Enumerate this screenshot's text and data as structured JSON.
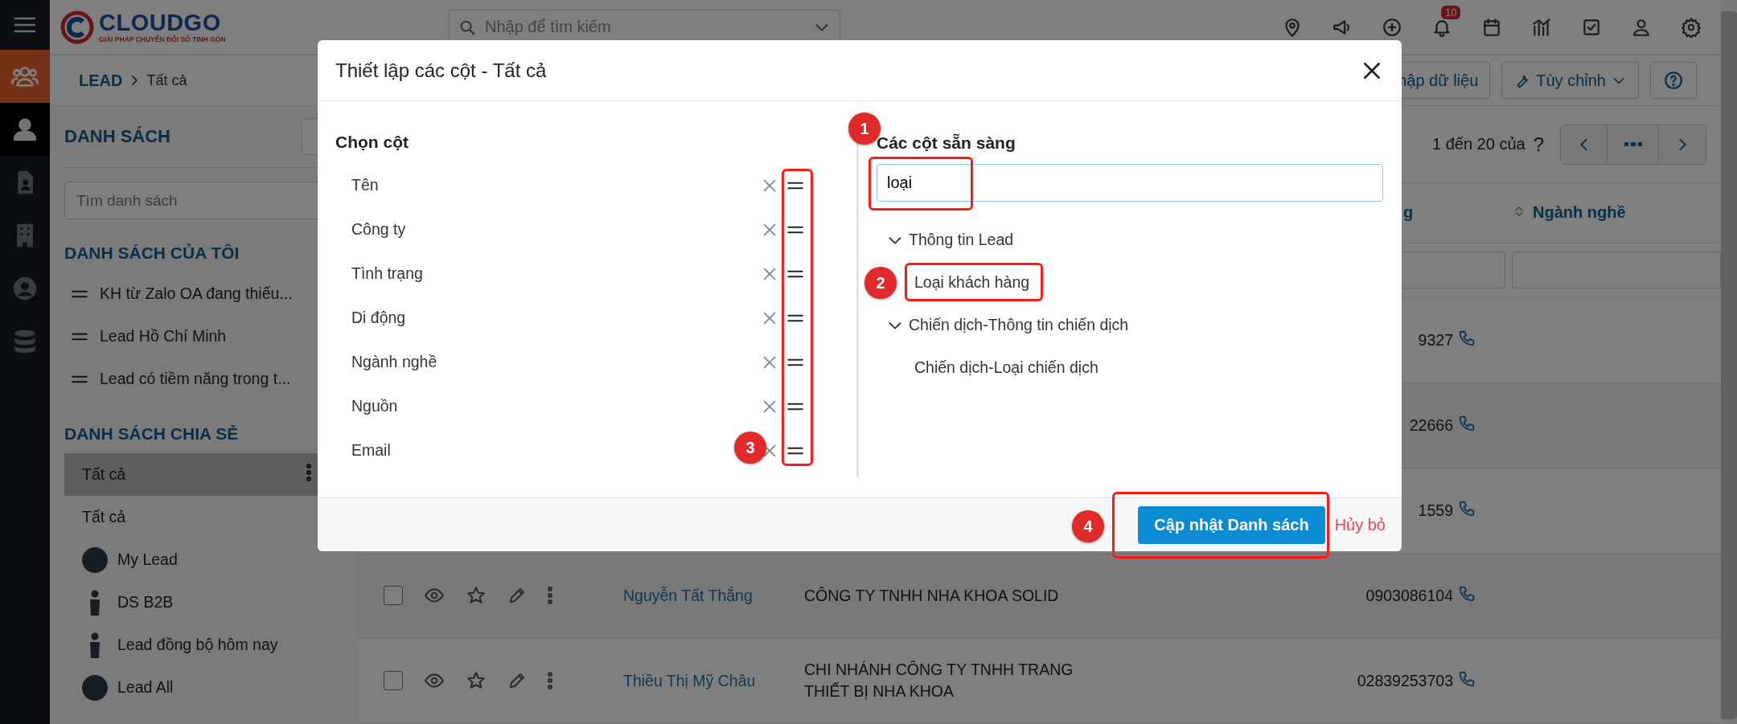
{
  "header": {
    "logo": {
      "name": "CLOUDGO",
      "tagline": "GIẢI PHÁP CHUYỂN ĐỔI SỐ TINH GỌN"
    },
    "search": {
      "placeholder": "Nhập để tìm kiếm"
    },
    "notification_badge": "10"
  },
  "rail": [
    {
      "kind": "module"
    },
    {
      "kind": "item",
      "selected": true
    },
    {
      "kind": "item",
      "selected": false
    },
    {
      "kind": "item",
      "selected": false
    },
    {
      "kind": "item",
      "selected": false
    },
    {
      "kind": "item",
      "selected": false
    }
  ],
  "breadcrumb": {
    "module": "LEAD",
    "page": "Tất cả"
  },
  "toolbar_buttons": [
    {
      "label": "hập dữ liệu",
      "kind": "plain"
    },
    {
      "label": "Tùy chỉnh",
      "kind": "menu"
    }
  ],
  "sidebar": {
    "title": "DANH SÁCH",
    "search": {
      "placeholder": "Tìm danh sách"
    },
    "sections": [
      {
        "title": "DANH SÁCH CỦA TÔI",
        "items": [
          {
            "label": "KH từ Zalo OA đang thiếu...",
            "kind": "handle",
            "selected": false
          },
          {
            "label": "Lead Hồ Chí Minh",
            "kind": "handle",
            "selected": false
          },
          {
            "label": "Lead có tiềm năng trong t...",
            "kind": "handle",
            "selected": false
          }
        ]
      },
      {
        "title": "DANH SÁCH CHIA SẺ",
        "items": [
          {
            "label": "Tất cả",
            "kind": "plain",
            "selected": true
          },
          {
            "label": "Tất cả",
            "kind": "plain",
            "selected": false
          },
          {
            "label": "My Lead",
            "kind": "avatar",
            "selected": false
          },
          {
            "label": "DS B2B",
            "kind": "figure",
            "selected": false
          },
          {
            "label": "Lead đồng bộ hôm nay",
            "kind": "figure",
            "selected": false
          },
          {
            "label": "Lead All",
            "kind": "avatar",
            "selected": false
          }
        ]
      }
    ]
  },
  "pagination": {
    "range": "1 đến 20 của",
    "total": "?"
  },
  "table": {
    "columns": [
      {
        "label": "g",
        "sortable": false
      },
      {
        "label": "Ngành nghề",
        "sortable": true
      }
    ],
    "rows": [
      {
        "phone": "9327"
      },
      {
        "phone": "22666"
      },
      {
        "phone": "1559"
      },
      {
        "checked": false,
        "name": "Nguyễn Tất Thắng",
        "company": "CÔNG TY TNHH NHA KHOA SOLID",
        "phone": "0903086104"
      },
      {
        "checked": false,
        "name": "Thiều Thị Mỹ Châu",
        "company": "CHI NHÁNH CÔNG TY TNHH TRANG THIẾT BỊ NHA KHOA",
        "phone": "02839253703"
      }
    ]
  },
  "modal": {
    "title": "Thiết lập các cột - Tất cả",
    "selected_columns": {
      "title": "Chọn cột",
      "items": [
        {
          "label": "Tên"
        },
        {
          "label": "Công ty"
        },
        {
          "label": "Tình trạng"
        },
        {
          "label": "Di động"
        },
        {
          "label": "Ngành nghề"
        },
        {
          "label": "Nguồn"
        },
        {
          "label": "Email"
        }
      ]
    },
    "available_columns": {
      "title": "Các cột sẵn sàng",
      "search": {
        "value": "loại"
      },
      "groups": [
        {
          "label": "Thông tin Lead",
          "expanded": true,
          "children": [
            {
              "label": "Loại khách hàng"
            }
          ]
        },
        {
          "label": "Chiến dịch-Thông tin chiến dịch",
          "expanded": true,
          "children": [
            {
              "label": "Chiến dịch-Loại chiến dịch"
            }
          ]
        }
      ]
    },
    "primary_button": "Cập nhật Danh sách",
    "cancel_link": "Hủy bỏ"
  },
  "annotations": [
    {
      "number": "1"
    },
    {
      "number": "2"
    },
    {
      "number": "3"
    },
    {
      "number": "4"
    }
  ]
}
